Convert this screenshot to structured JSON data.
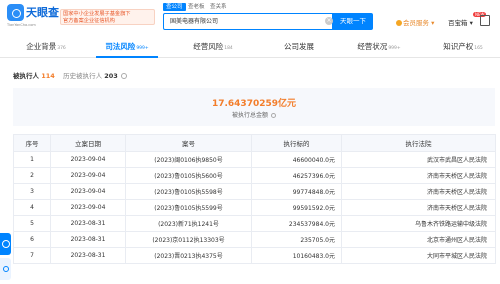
{
  "header": {
    "logo_text": "天眼查",
    "logo_url": "TianYanCha.com",
    "promo_line1": "国家中小企业发展子基金旗下",
    "promo_line2": "官方备案企业征信机构",
    "search_tabs": [
      "查公司",
      "查老板",
      "查关系"
    ],
    "search_value": "国美电器有限公司",
    "search_button": "天眼一下",
    "vip_label": "会员服务",
    "baobao_label": "百宝箱",
    "new_badge": "NEW"
  },
  "nav": {
    "items": [
      {
        "label": "企业背景",
        "count": "376"
      },
      {
        "label": "司法风险",
        "count": "999+"
      },
      {
        "label": "经营风险",
        "count": "184"
      },
      {
        "label": "公司发展",
        "count": ""
      },
      {
        "label": "经营状况",
        "count": "999+"
      },
      {
        "label": "知识产权",
        "count": "165"
      }
    ]
  },
  "subtabs": {
    "active_label": "被执行人",
    "active_count": "114",
    "history_label": "历史被执行人",
    "history_count": "203"
  },
  "summary": {
    "amount": "17.64370259",
    "unit": "亿元",
    "label": "被执行总金额"
  },
  "table": {
    "headers": [
      "序号",
      "立案日期",
      "案号",
      "执行标的",
      "执行法院"
    ],
    "rows": [
      [
        "1",
        "2023-09-04",
        "(2023)闽0106执9850号",
        "46600040.0元",
        "武汉市武昌区人民法院"
      ],
      [
        "2",
        "2023-09-04",
        "(2023)鲁0105执5600号",
        "46257396.0元",
        "济南市天桥区人民法院"
      ],
      [
        "3",
        "2023-09-04",
        "(2023)鲁0105执5598号",
        "99774848.0元",
        "济南市天桥区人民法院"
      ],
      [
        "4",
        "2023-09-04",
        "(2023)鲁0105执5599号",
        "99591592.0元",
        "济南市天桥区人民法院"
      ],
      [
        "5",
        "2023-08-31",
        "(2023)新71执1241号",
        "234537984.0元",
        "乌鲁木齐铁路运输中级法院"
      ],
      [
        "6",
        "2023-08-31",
        "(2023)京0112执13303号",
        "235705.0元",
        "北京市通州区人民法院"
      ],
      [
        "7",
        "2023-08-31",
        "(2023)晋0213执4375号",
        "10160483.0元",
        "大同市平城区人民法院"
      ]
    ]
  },
  "colors": {
    "accent": "#0084ff",
    "amount": "#f37d2a",
    "brand": "#0e6ad8"
  }
}
